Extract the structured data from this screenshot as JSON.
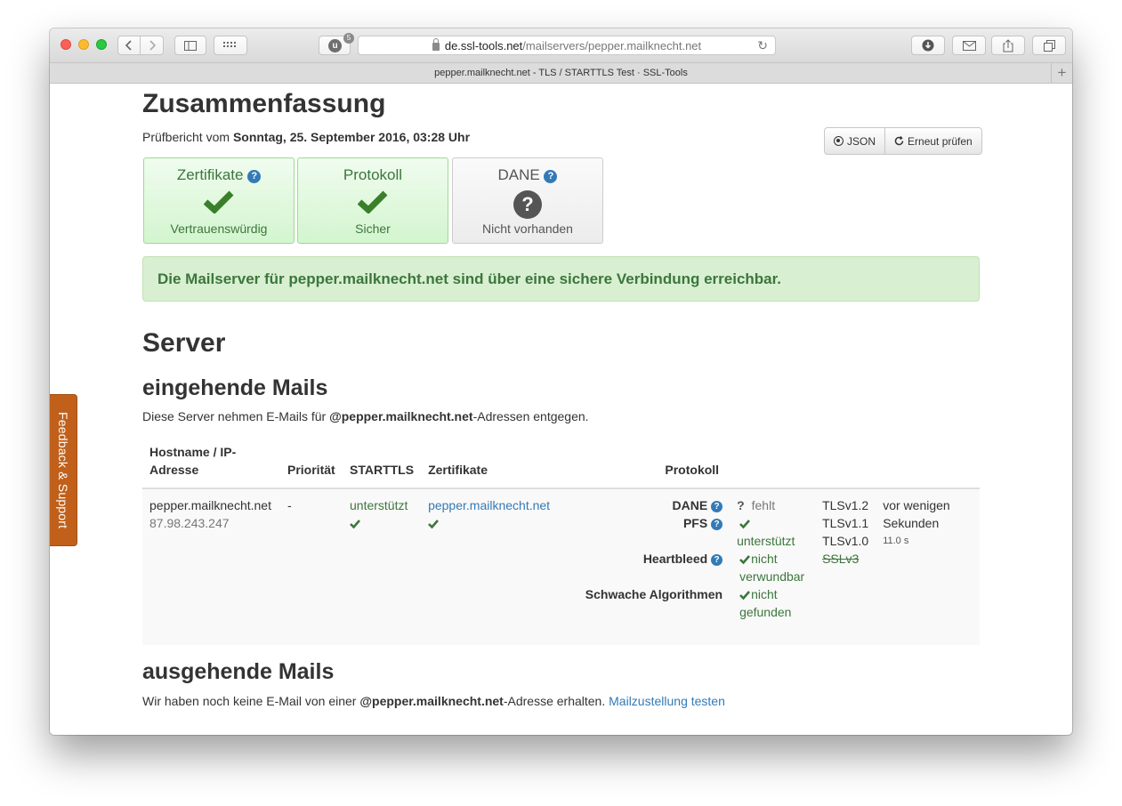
{
  "browser": {
    "url_domain": "de.ssl-tools.net",
    "url_path": "/mailservers/pepper.mailknecht.net",
    "tab_title": "pepper.mailknecht.net - TLS / STARTTLS Test · SSL-Tools",
    "extension_badge": "5",
    "extension_letter": "u",
    "new_tab_label": "+"
  },
  "summary": {
    "title": "Zusammenfassung",
    "report_prefix": "Prüfbericht vom",
    "report_date": "Sonntag, 25. September 2016, 03:28 Uhr",
    "json_button": "JSON",
    "recheck_button": "Erneut prüfen"
  },
  "boxes": [
    {
      "title": "Zertifikate",
      "status": "Vertrauenswürdig"
    },
    {
      "title": "Protokoll",
      "status": "Sicher"
    },
    {
      "title": "DANE",
      "status": "Nicht vorhanden"
    }
  ],
  "alert": "Die Mailserver für pepper.mailknecht.net sind über eine sichere Verbindung erreichbar.",
  "server": {
    "title": "Server",
    "incoming": {
      "title": "eingehende Mails",
      "desc_prefix": "Diese Server nehmen E-Mails für",
      "desc_domain": "@pepper.mailknecht.net",
      "desc_suffix": "-Adressen entgegen.",
      "headers": {
        "host": "Hostname / IP-Adresse",
        "priority": "Priorität",
        "starttls": "STARTTLS",
        "cert": "Zertifikate",
        "protocol": "Protokoll"
      },
      "row": {
        "hostname": "pepper.mailknecht.net",
        "ip": "87.98.243.247",
        "priority": "-",
        "starttls": "unterstützt",
        "cert": "pepper.mailknecht.net",
        "checks": [
          {
            "label": "DANE",
            "value": "fehlt"
          },
          {
            "label": "PFS",
            "value": "unterstützt"
          },
          {
            "label": "Heartbleed",
            "value": "nicht verwundbar"
          },
          {
            "label": "Schwache Algorithmen",
            "value": "nicht gefunden"
          }
        ],
        "versions": [
          "TLSv1.2",
          "TLSv1.1",
          "TLSv1.0",
          "SSLv3"
        ],
        "time": "vor wenigen Sekunden",
        "duration": "11.0 s"
      }
    },
    "outgoing": {
      "title": "ausgehende Mails",
      "desc_prefix": "Wir haben noch keine E-Mail von einer",
      "desc_domain": "@pepper.mailknecht.net",
      "desc_suffix": "-Adresse erhalten.",
      "link": "Mailzustellung testen"
    }
  },
  "feedback_tab": "Feedback & Support",
  "colors": {
    "success_text": "#3c763d",
    "link": "#337ab7",
    "feedback_bg": "#c0601b",
    "alert_bg": "#d8f0d1"
  }
}
